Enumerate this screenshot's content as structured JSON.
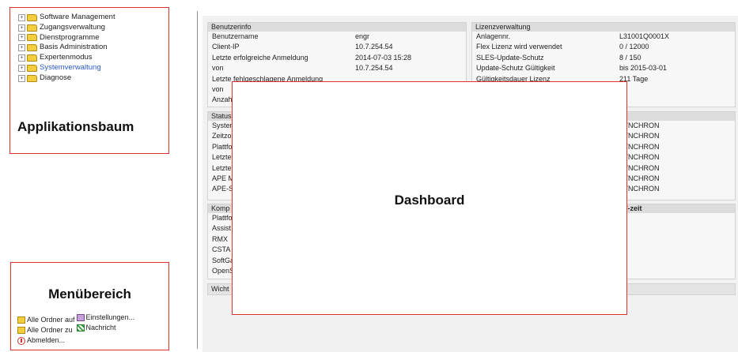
{
  "tree": {
    "title": "Applikationsbaum",
    "items": [
      {
        "label": "Software Management"
      },
      {
        "label": "Zugangsverwaltung"
      },
      {
        "label": "Dienstprogramme"
      },
      {
        "label": "Basis Administration"
      },
      {
        "label": "Expertenmodus"
      },
      {
        "label": "Systemverwaltung"
      },
      {
        "label": "Diagnose"
      }
    ],
    "active_color": "#2b58c6"
  },
  "menu": {
    "title": "Menübereich",
    "expand_all": "Alle Ordner auf",
    "collapse_all": "Alle Ordner zu",
    "logout": "Abmelden...",
    "settings": "Einstellungen...",
    "message": "Nachricht"
  },
  "dashboard": {
    "title": "Dashboard",
    "benutzerinfo": {
      "header": "Benutzerinfo",
      "rows": [
        {
          "k": "Benutzername",
          "v": "engr"
        },
        {
          "k": "Client-IP",
          "v": "10.7.254.54"
        },
        {
          "k": "Letzte erfolgreiche Anmeldung",
          "v": "2014-07-03 15:28"
        },
        {
          "k": "von",
          "v": "10.7.254.54"
        },
        {
          "k": "Letzte fehlgeschlagene Anmeldung",
          "v": ""
        },
        {
          "k": "von",
          "v": ""
        },
        {
          "k": "Anzah",
          "v": ""
        }
      ]
    },
    "lizenz": {
      "header": "Lizenzverwaltung",
      "rows": [
        {
          "k": "Anlagennr.",
          "v": "L31001Q0001X"
        },
        {
          "k": "Flex Lizenz wird verwendet",
          "v": "0 / 12000"
        },
        {
          "k": "SLES-Update-Schutz",
          "v": "8 / 150"
        },
        {
          "k": "Update-Schutz Gültigkeit",
          "v": "bis 2015-03-01"
        },
        {
          "k": "Gültigkeitsdauer Lizenz",
          "v": "211 Tage"
        }
      ]
    },
    "status": {
      "header": "Status",
      "rows": [
        {
          "k": "System",
          "v": "YNCHRON"
        },
        {
          "k": "Zeitzo",
          "v": "YNCHRON"
        },
        {
          "k": "Plattfo",
          "v": "YNCHRON"
        },
        {
          "k": "Letzte",
          "v": "YNCHRON"
        },
        {
          "k": "Letzte",
          "v": "YNCHRON"
        },
        {
          "k": "APE M",
          "v": "YNCHRON"
        },
        {
          "k": "APE-S",
          "v": "YNCHRON"
        }
      ]
    },
    "komp": {
      "header": "Komp",
      "subheader": "m/-zeit",
      "rows": [
        {
          "k": "Plattfo"
        },
        {
          "k": "Assist"
        },
        {
          "k": "RMX"
        },
        {
          "k": "CSTA"
        },
        {
          "k": "SoftGa"
        },
        {
          "k": "OpenS"
        }
      ]
    },
    "wichtig": {
      "header": "Wicht"
    }
  }
}
